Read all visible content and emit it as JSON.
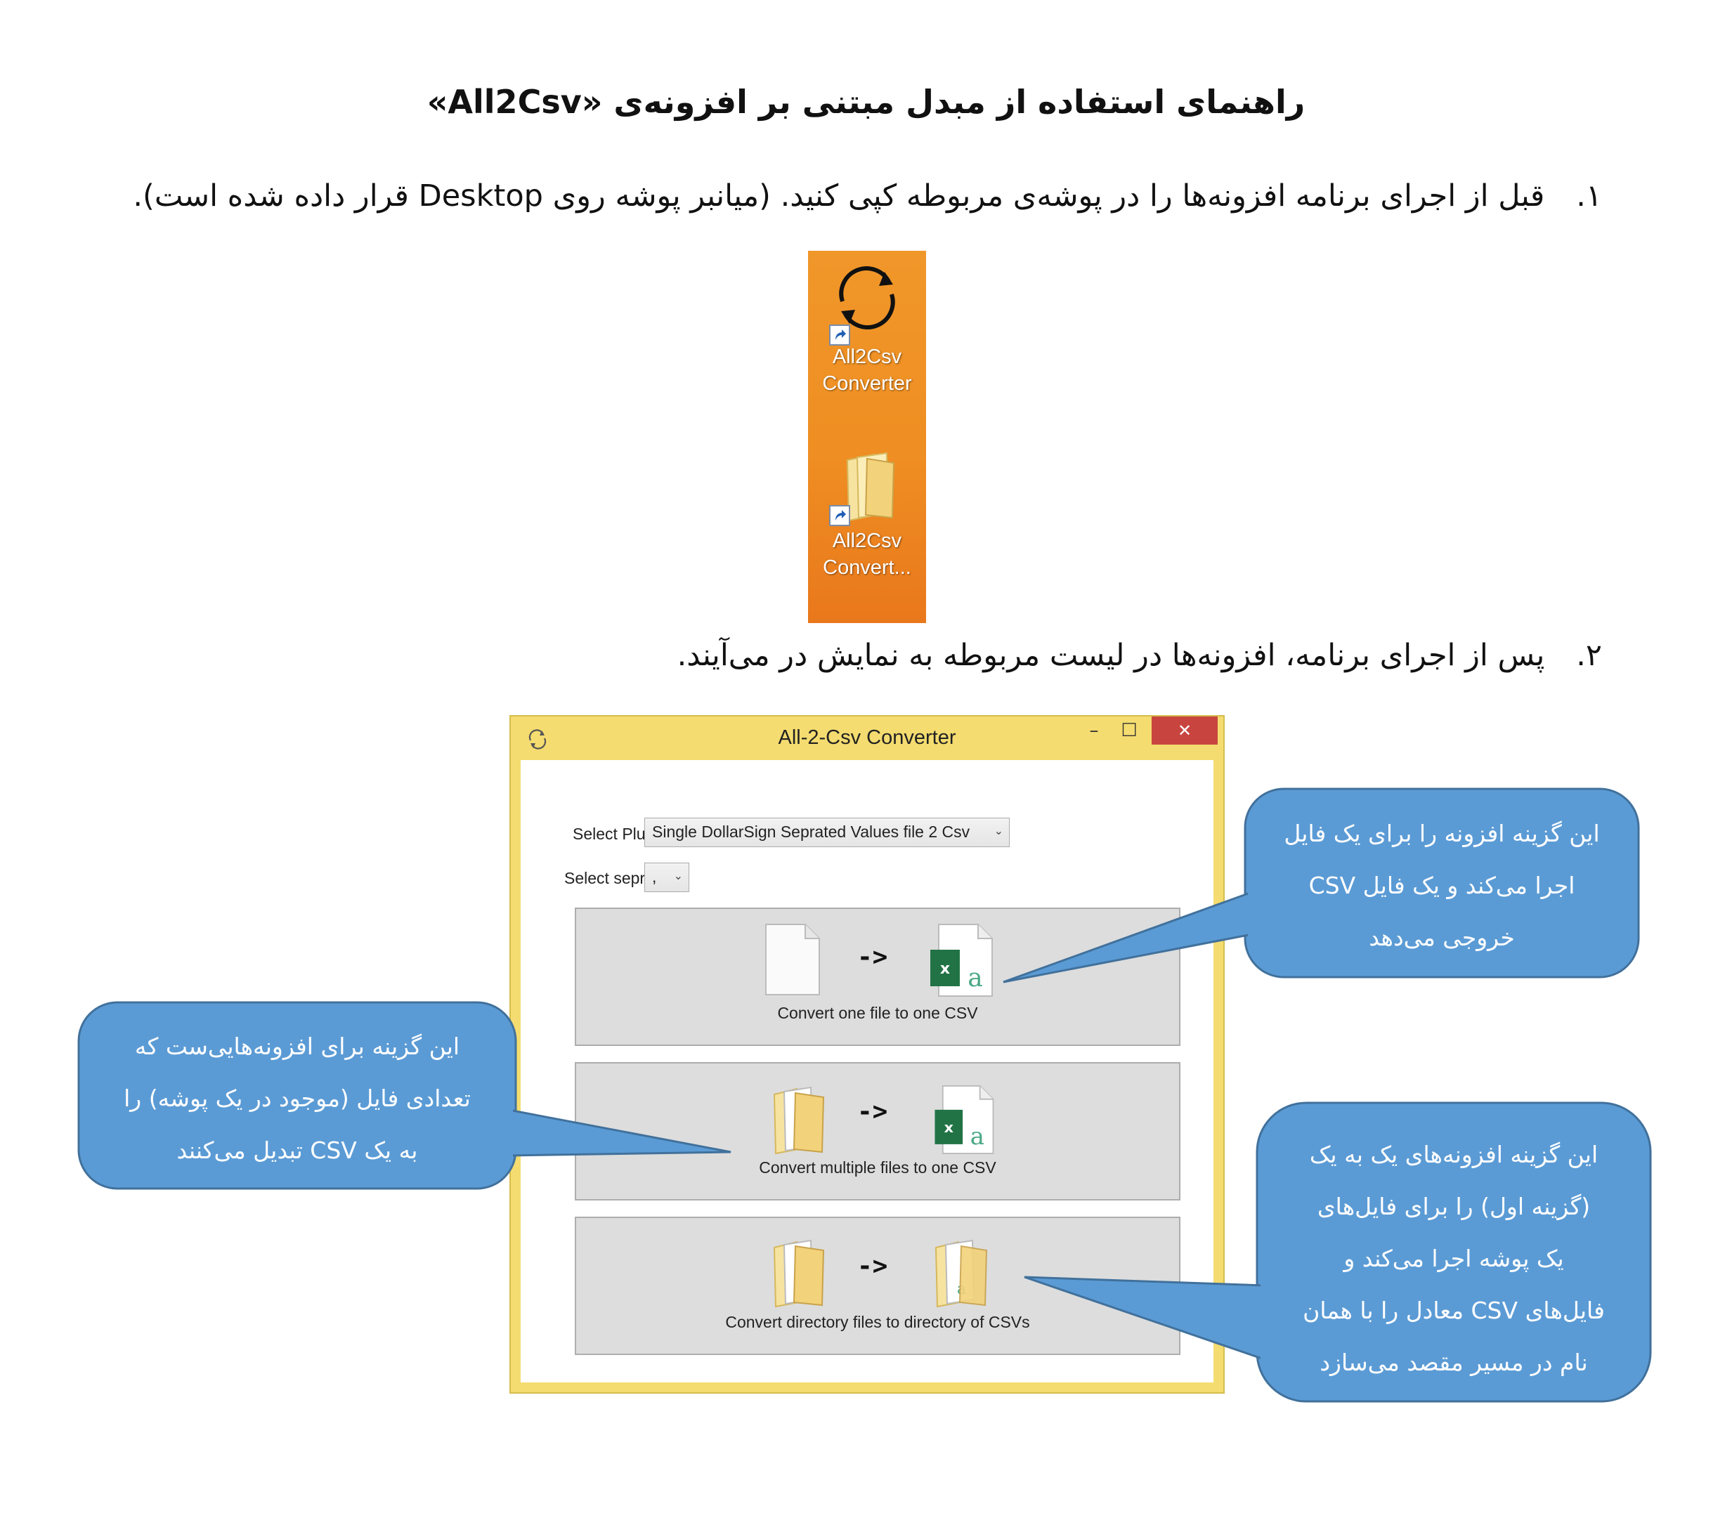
{
  "document": {
    "title": "راهنمای استفاده از مبدل مبتنی بر افزونه‌ی «All2Csv»",
    "steps": [
      {
        "number": "۱.",
        "text_before": "قبل از اجرای برنامه افزونه‌ها را در پوشه‌ی مربوطه کپی کنید. (میانبر پوشه روی",
        "highlight": "Desktop",
        "text_after": "قرار داده شده است)."
      },
      {
        "number": "۲.",
        "text": "پس از اجرای برنامه، افزونه‌ها در لیست مربوطه به نمایش در می‌آیند."
      }
    ]
  },
  "desktop": {
    "background": "#ef8e22",
    "icons": [
      {
        "name": "app-shortcut",
        "icon": "refresh-arrows-icon",
        "line1": "All2Csv",
        "line2": "Converter"
      },
      {
        "name": "folder-shortcut",
        "icon": "folder-icon",
        "line1": "All2Csv",
        "line2": "Convert..."
      }
    ]
  },
  "window": {
    "title": "All-2-Csv Converter",
    "frame_color": "#f4dc70",
    "close_color": "#c8453f",
    "controls": {
      "minimize": "–",
      "maximize": "☐",
      "close": "✕"
    },
    "plugin_label": "Select Plug-in:",
    "plugin_value": "Single DollarSign Seprated Values file 2 Csv",
    "separator_label": "Select seprator:",
    "separator_value": ",",
    "arrow_text": "->",
    "buttons": [
      {
        "label": "Convert one file to one CSV",
        "from_icon": "file-icon",
        "to_icon": "excel-csv-icon"
      },
      {
        "label": "Convert multiple files to one CSV",
        "from_icon": "folder-icon",
        "to_icon": "excel-csv-icon"
      },
      {
        "label": "Convert directory files to directory of CSVs",
        "from_icon": "folder-icon",
        "to_icon": "csv-folder-icon"
      }
    ]
  },
  "callouts": {
    "color": "#5b9bd5",
    "one_file": [
      "این گزینه افزونه را برای یک فایل",
      "اجرا می‌کند و یک فایل CSV",
      "خروجی می‌دهد"
    ],
    "multiple_files": [
      "این گزینه برای افزونه‌هایی‌ست که",
      "تعدادی فایل (موجود در یک پوشه) را",
      "به یک CSV تبدیل می‌کنند"
    ],
    "directory": [
      "این گزینه افزونه‌های یک به یک",
      "(گزینه اول) را برای فایل‌های",
      "یک پوشه اجرا می‌کند و",
      "فایل‌های CSV معادل را با همان",
      "نام در مسیر مقصد می‌سازد"
    ]
  }
}
